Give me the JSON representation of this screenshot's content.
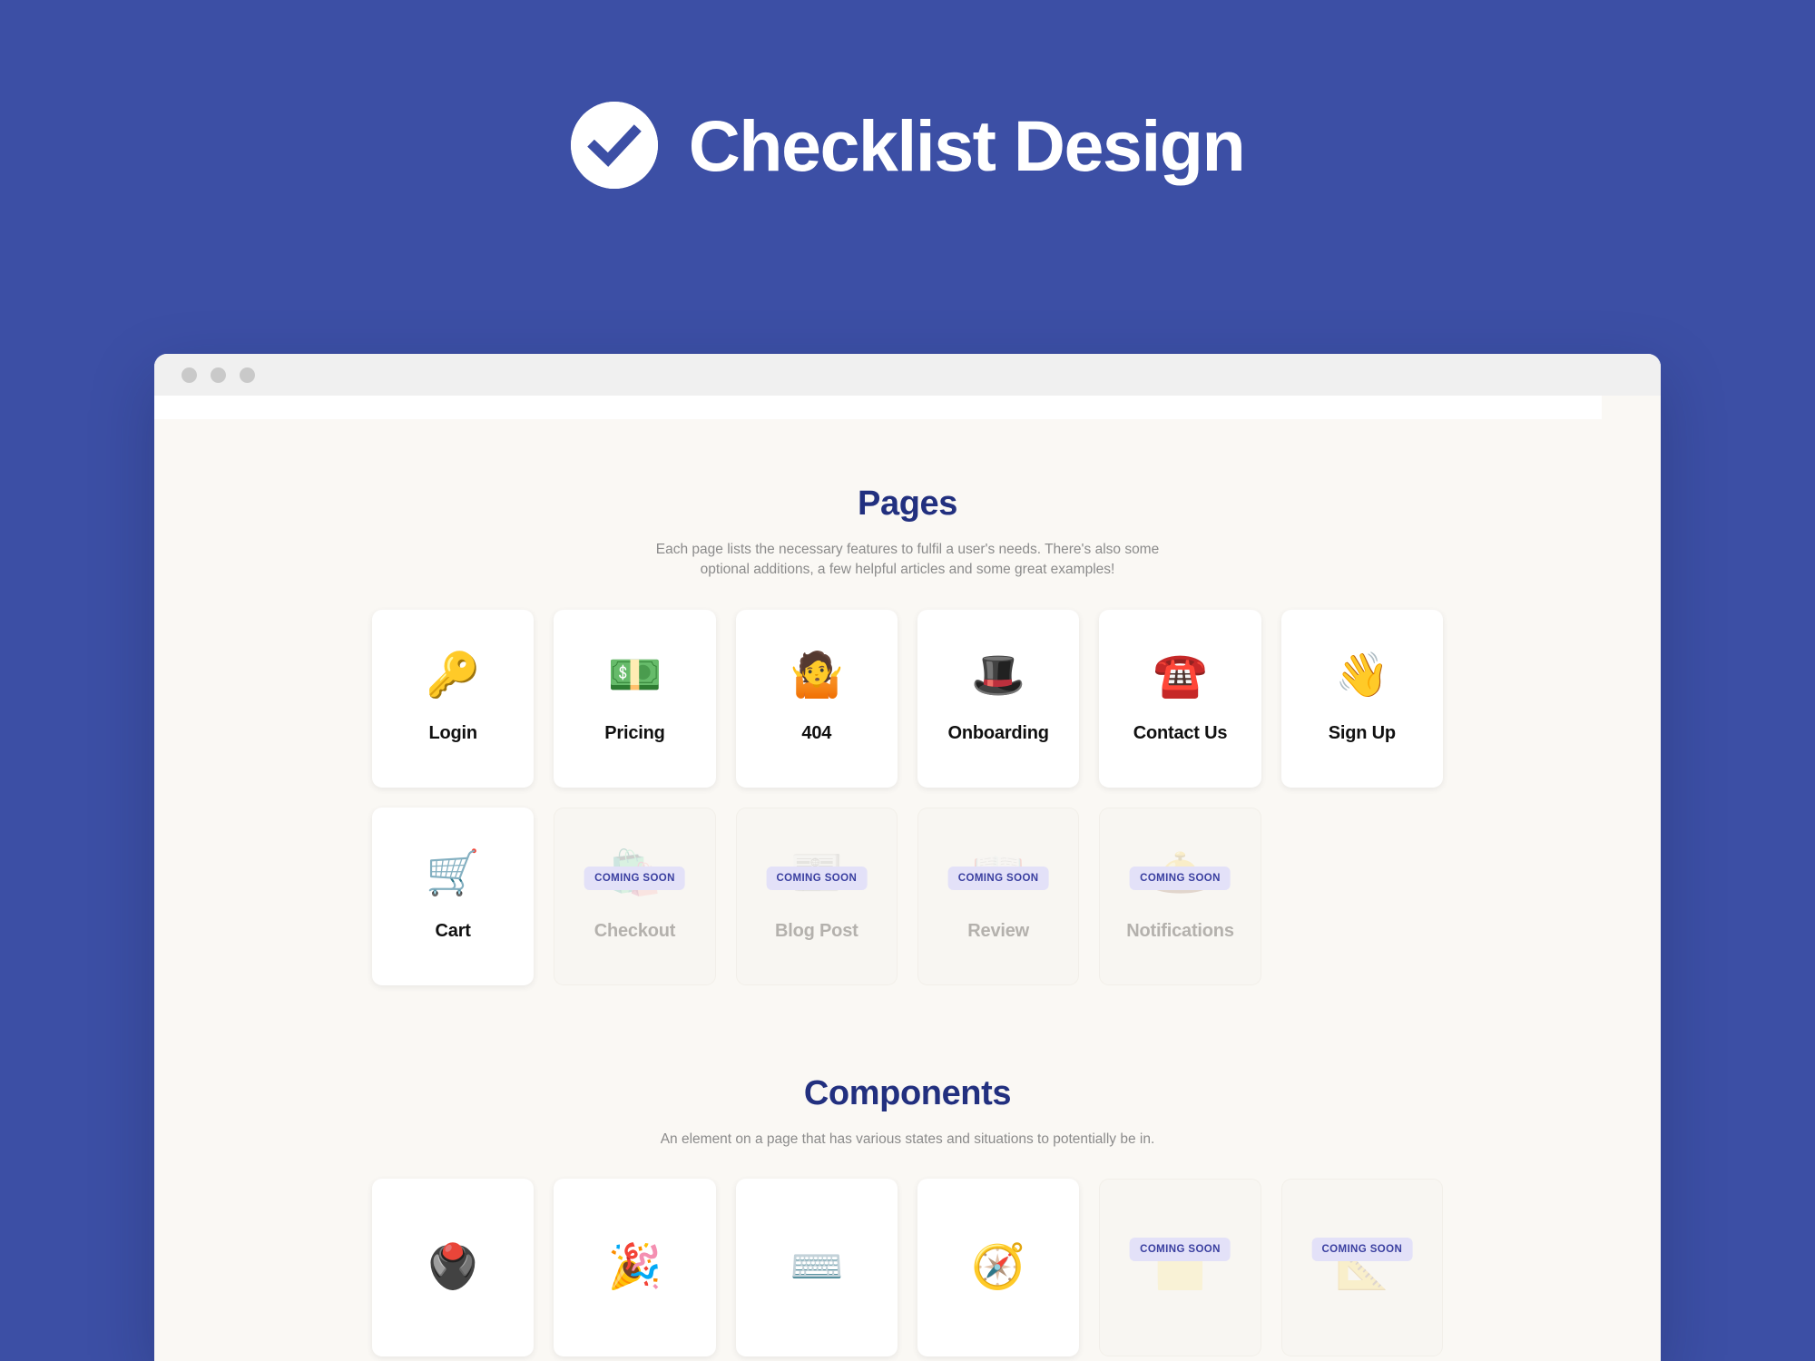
{
  "hero": {
    "title": "Checklist Design",
    "logo_icon": "check-circle-icon",
    "background_color": "#3c4fa5"
  },
  "browser": {
    "traffic_lights": [
      "close-dot",
      "minimize-dot",
      "maximize-dot"
    ],
    "urlbar_value": ""
  },
  "theme": {
    "page_background": "#faf8f4",
    "heading_navy": "#22307f",
    "badge_background": "#e3e1f8",
    "badge_text": "#3a3fa0",
    "muted_text": "#8b8b8b"
  },
  "sections": [
    {
      "id": "pages",
      "title": "Pages",
      "subtitle": "Each page lists the necessary features to fulfil a user's needs. There's also some optional additions, a few helpful articles and some great examples!",
      "cards": [
        {
          "label": "Login",
          "emoji": "🔑",
          "icon_name": "key-icon",
          "coming_soon": false,
          "badge": ""
        },
        {
          "label": "Pricing",
          "emoji": "💵",
          "icon_name": "banknote-icon",
          "coming_soon": false,
          "badge": ""
        },
        {
          "label": "404",
          "emoji": "🤷",
          "icon_name": "shrug-icon",
          "coming_soon": false,
          "badge": ""
        },
        {
          "label": "Onboarding",
          "emoji": "🎩",
          "icon_name": "top-hat-icon",
          "coming_soon": false,
          "badge": ""
        },
        {
          "label": "Contact Us",
          "emoji": "☎️",
          "icon_name": "telephone-icon",
          "coming_soon": false,
          "badge": ""
        },
        {
          "label": "Sign Up",
          "emoji": "👋",
          "icon_name": "waving-hand-icon",
          "coming_soon": false,
          "badge": ""
        },
        {
          "label": "Cart",
          "emoji": "🛒",
          "icon_name": "shopping-cart-icon",
          "coming_soon": false,
          "badge": ""
        },
        {
          "label": "Checkout",
          "emoji": "🛍️",
          "icon_name": "shopping-bags-icon",
          "coming_soon": true,
          "badge": "COMING SOON"
        },
        {
          "label": "Blog Post",
          "emoji": "📰",
          "icon_name": "newspaper-icon",
          "coming_soon": true,
          "badge": "COMING SOON"
        },
        {
          "label": "Review",
          "emoji": "📖",
          "icon_name": "open-book-icon",
          "coming_soon": true,
          "badge": "COMING SOON"
        },
        {
          "label": "Notifications",
          "emoji": "🛎️",
          "icon_name": "bellhop-bell-icon",
          "coming_soon": true,
          "badge": "COMING SOON"
        }
      ]
    },
    {
      "id": "components",
      "title": "Components",
      "subtitle": "An element on a page that has various states and situations to potentially be in.",
      "cards": [
        {
          "label": "",
          "emoji": "🖲️",
          "icon_name": "trackball-icon",
          "coming_soon": false,
          "badge": ""
        },
        {
          "label": "",
          "emoji": "🎉",
          "icon_name": "party-popper-icon",
          "coming_soon": false,
          "badge": ""
        },
        {
          "label": "",
          "emoji": "⌨️",
          "icon_name": "keyboard-icon",
          "coming_soon": false,
          "badge": ""
        },
        {
          "label": "",
          "emoji": "🧭",
          "icon_name": "compass-icon",
          "coming_soon": false,
          "badge": ""
        },
        {
          "label": "",
          "emoji": "🗂️",
          "icon_name": "card-index-icon",
          "coming_soon": true,
          "badge": "COMING SOON"
        },
        {
          "label": "",
          "emoji": "📐",
          "icon_name": "triangular-ruler-icon",
          "coming_soon": true,
          "badge": "COMING SOON"
        }
      ]
    }
  ]
}
